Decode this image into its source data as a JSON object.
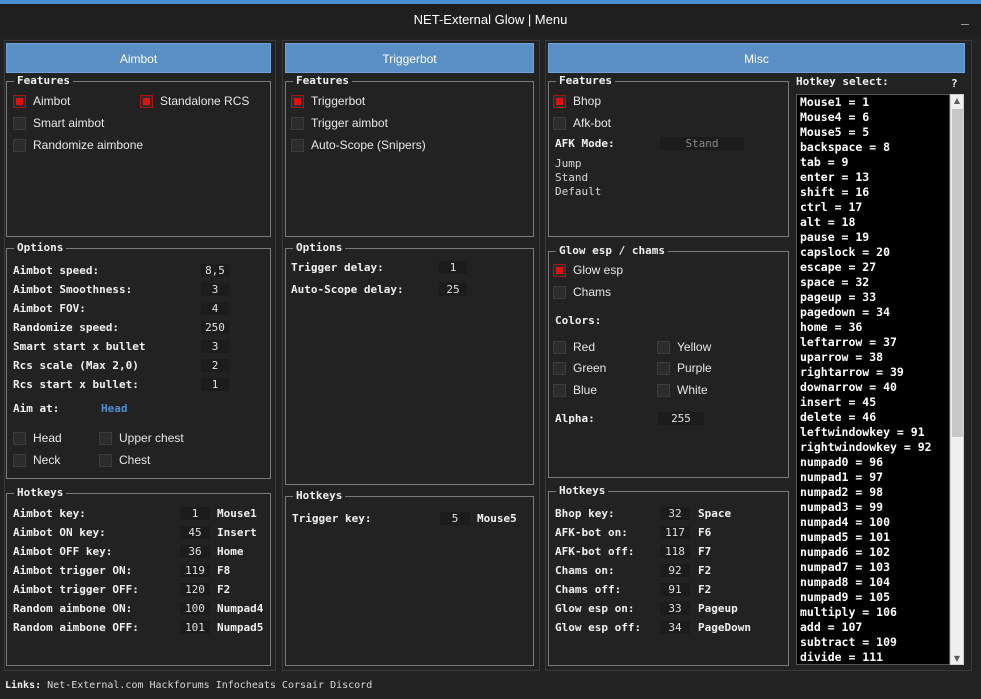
{
  "window": {
    "title": "NET-External Glow | Menu",
    "minimize": "_"
  },
  "columns": {
    "aimbot": "Aimbot",
    "triggerbot": "Triggerbot",
    "misc": "Misc"
  },
  "aimbot": {
    "features_label": "Features",
    "features": {
      "aimbot": {
        "label": "Aimbot",
        "checked": true
      },
      "standalone_rcs": {
        "label": "Standalone RCS",
        "checked": true
      },
      "smart_aimbot": {
        "label": "Smart aimbot",
        "checked": false
      },
      "randomize_aimbone": {
        "label": "Randomize aimbone",
        "checked": false
      }
    },
    "options_label": "Options",
    "options": [
      {
        "label": "Aimbot speed:",
        "value": "8,5"
      },
      {
        "label": "Aimbot Smoothness:",
        "value": "3"
      },
      {
        "label": "Aimbot FOV:",
        "value": "4"
      },
      {
        "label": "Randomize speed:",
        "value": "250"
      },
      {
        "label": "Smart start x bullet",
        "value": "3"
      },
      {
        "label": "Rcs scale (Max 2,0)",
        "value": "2"
      },
      {
        "label": "Rcs start x bullet:",
        "value": "1"
      }
    ],
    "aim_at_label": "Aim at:",
    "aim_at_value": "Head",
    "bones": {
      "head": "Head",
      "upper_chest": "Upper chest",
      "neck": "Neck",
      "chest": "Chest"
    },
    "hotkeys_label": "Hotkeys",
    "hotkeys": [
      {
        "label": "Aimbot key:",
        "code": "1",
        "key": "Mouse1"
      },
      {
        "label": "Aimbot ON key:",
        "code": "45",
        "key": "Insert"
      },
      {
        "label": "Aimbot OFF key:",
        "code": "36",
        "key": "Home"
      },
      {
        "label": "Aimbot trigger ON:",
        "code": "119",
        "key": "F8"
      },
      {
        "label": "Aimbot trigger OFF:",
        "code": "120",
        "key": "F2"
      },
      {
        "label": "Random aimbone ON:",
        "code": "100",
        "key": "Numpad4"
      },
      {
        "label": "Random aimbone OFF:",
        "code": "101",
        "key": "Numpad5"
      }
    ]
  },
  "triggerbot": {
    "features_label": "Features",
    "features": {
      "triggerbot": {
        "label": "Triggerbot",
        "checked": true
      },
      "trigger_aimbot": {
        "label": "Trigger aimbot",
        "checked": false
      },
      "auto_scope": {
        "label": "Auto-Scope (Snipers)",
        "checked": false
      }
    },
    "options_label": "Options",
    "options": [
      {
        "label": "Trigger delay:",
        "value": "1"
      },
      {
        "label": "Auto-Scope delay:",
        "value": "25"
      }
    ],
    "hotkeys_label": "Hotkeys",
    "hotkeys": [
      {
        "label": "Trigger key:",
        "code": "5",
        "key": "Mouse5"
      }
    ]
  },
  "misc": {
    "features_label": "Features",
    "features": {
      "bhop": {
        "label": "Bhop",
        "checked": true
      },
      "afk_bot": {
        "label": "Afk-bot",
        "checked": false
      }
    },
    "afk_mode_label": "AFK Mode:",
    "afk_mode_value": "Stand",
    "afk_modes": [
      "Jump",
      "Stand",
      "Default"
    ],
    "glow_label": "Glow esp / chams",
    "glow": {
      "glow_esp": {
        "label": "Glow esp",
        "checked": true
      },
      "chams": {
        "label": "Chams",
        "checked": false
      }
    },
    "colors_label": "Colors:",
    "colors": {
      "red": "Red",
      "yellow": "Yellow",
      "green": "Green",
      "purple": "Purple",
      "blue": "Blue",
      "white": "White"
    },
    "alpha_label": "Alpha:",
    "alpha_value": "255",
    "hotkeys_label": "Hotkeys",
    "hotkeys": [
      {
        "label": "Bhop key:",
        "code": "32",
        "key": "Space"
      },
      {
        "label": "AFK-bot on:",
        "code": "117",
        "key": "F6"
      },
      {
        "label": "AFK-bot off:",
        "code": "118",
        "key": "F7"
      },
      {
        "label": "Chams on:",
        "code": "92",
        "key": "F2"
      },
      {
        "label": "Chams off:",
        "code": "91",
        "key": "F2"
      },
      {
        "label": "Glow esp on:",
        "code": "33",
        "key": "Pageup"
      },
      {
        "label": "Glow esp off:",
        "code": "34",
        "key": "PageDown"
      }
    ]
  },
  "hotkey_select": {
    "label": "Hotkey select:",
    "help": "?",
    "items": [
      "Mouse1 = 1",
      "Mouse4 = 6",
      "Mouse5 = 5",
      "backspace = 8",
      "tab = 9",
      "enter = 13",
      "shift = 16",
      "ctrl = 17",
      "alt = 18",
      "pause = 19",
      "capslock = 20",
      "escape = 27",
      "space = 32",
      "pageup = 33",
      "pagedown = 34",
      "home = 36",
      "leftarrow = 37",
      "uparrow = 38",
      "rightarrow = 39",
      "downarrow = 40",
      "insert = 45",
      "delete = 46",
      "leftwindowkey = 91",
      "rightwindowkey = 92",
      "numpad0 = 96",
      "numpad1 = 97",
      "numpad2 = 98",
      "numpad3 = 99",
      "numpad4 = 100",
      "numpad5 = 101",
      "numpad6 = 102",
      "numpad7 = 103",
      "numpad8 = 104",
      "numpad9 = 105",
      "multiply = 106",
      "add = 107",
      "subtract = 109",
      "divide = 111"
    ]
  },
  "links": {
    "label": "Links:",
    "items": [
      "Net-External.com",
      "Hackforums",
      "Infocheats",
      "Corsair",
      "Discord"
    ]
  }
}
